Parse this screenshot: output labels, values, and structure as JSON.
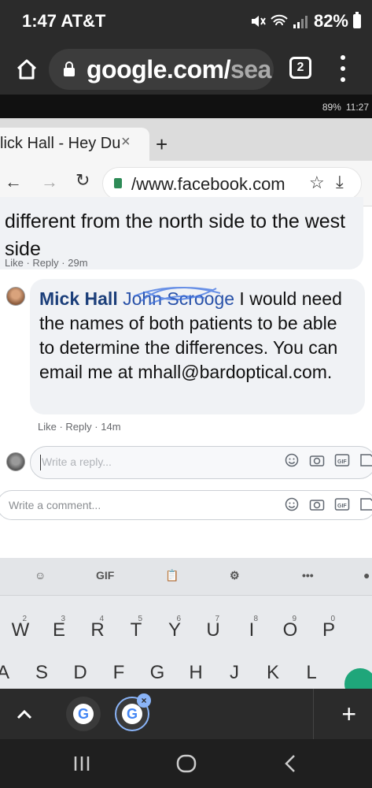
{
  "status_bar": {
    "time": "1:47 AT&T",
    "battery": "82%"
  },
  "chrome": {
    "url_main": "google.com/",
    "url_rest": "sea",
    "tab_count": "2"
  },
  "inner": {
    "status_right": "89%",
    "status_time": "11:27",
    "tab_title": "lick Hall - Hey Du",
    "tab_close": "×",
    "new_tab": "+",
    "url": "/www.facebook.com"
  },
  "fb": {
    "comment1_text": "different from the north side to the west side",
    "comment1_meta": {
      "like": "Like",
      "reply": "Reply",
      "time": "29m"
    },
    "comment2": {
      "author": "Mick Hall",
      "mention": "John Scrooge",
      "text": " I would need the names of both patients to be able to determine the differences. You can email me at mhall@bardoptical.com."
    },
    "comment2_meta": {
      "like": "Like",
      "reply": "Reply",
      "time": "14m"
    },
    "reply_placeholder": "Write a reply...",
    "comment_placeholder": "Write a comment...",
    "gif_label": "GIF"
  },
  "keyboard": {
    "tool_gif": "GIF",
    "tool_more": "•••",
    "row1": [
      {
        "key": "W",
        "num": "2"
      },
      {
        "key": "E",
        "num": "3"
      },
      {
        "key": "R",
        "num": "4"
      },
      {
        "key": "T",
        "num": "5"
      },
      {
        "key": "Y",
        "num": "6"
      },
      {
        "key": "U",
        "num": "7"
      },
      {
        "key": "I",
        "num": "8"
      },
      {
        "key": "O",
        "num": "9"
      },
      {
        "key": "P",
        "num": "0"
      }
    ],
    "row2": [
      "A",
      "S",
      "D",
      "F",
      "G",
      "H",
      "J",
      "K",
      "L"
    ]
  },
  "bottom": {
    "g_letter": "G",
    "plus": "+",
    "up": "^"
  },
  "colors": {
    "mention": "#2851a8",
    "author": "#1c3f7a",
    "bubble": "#f0f2f5",
    "chrome_dark": "#2b2b2b"
  }
}
